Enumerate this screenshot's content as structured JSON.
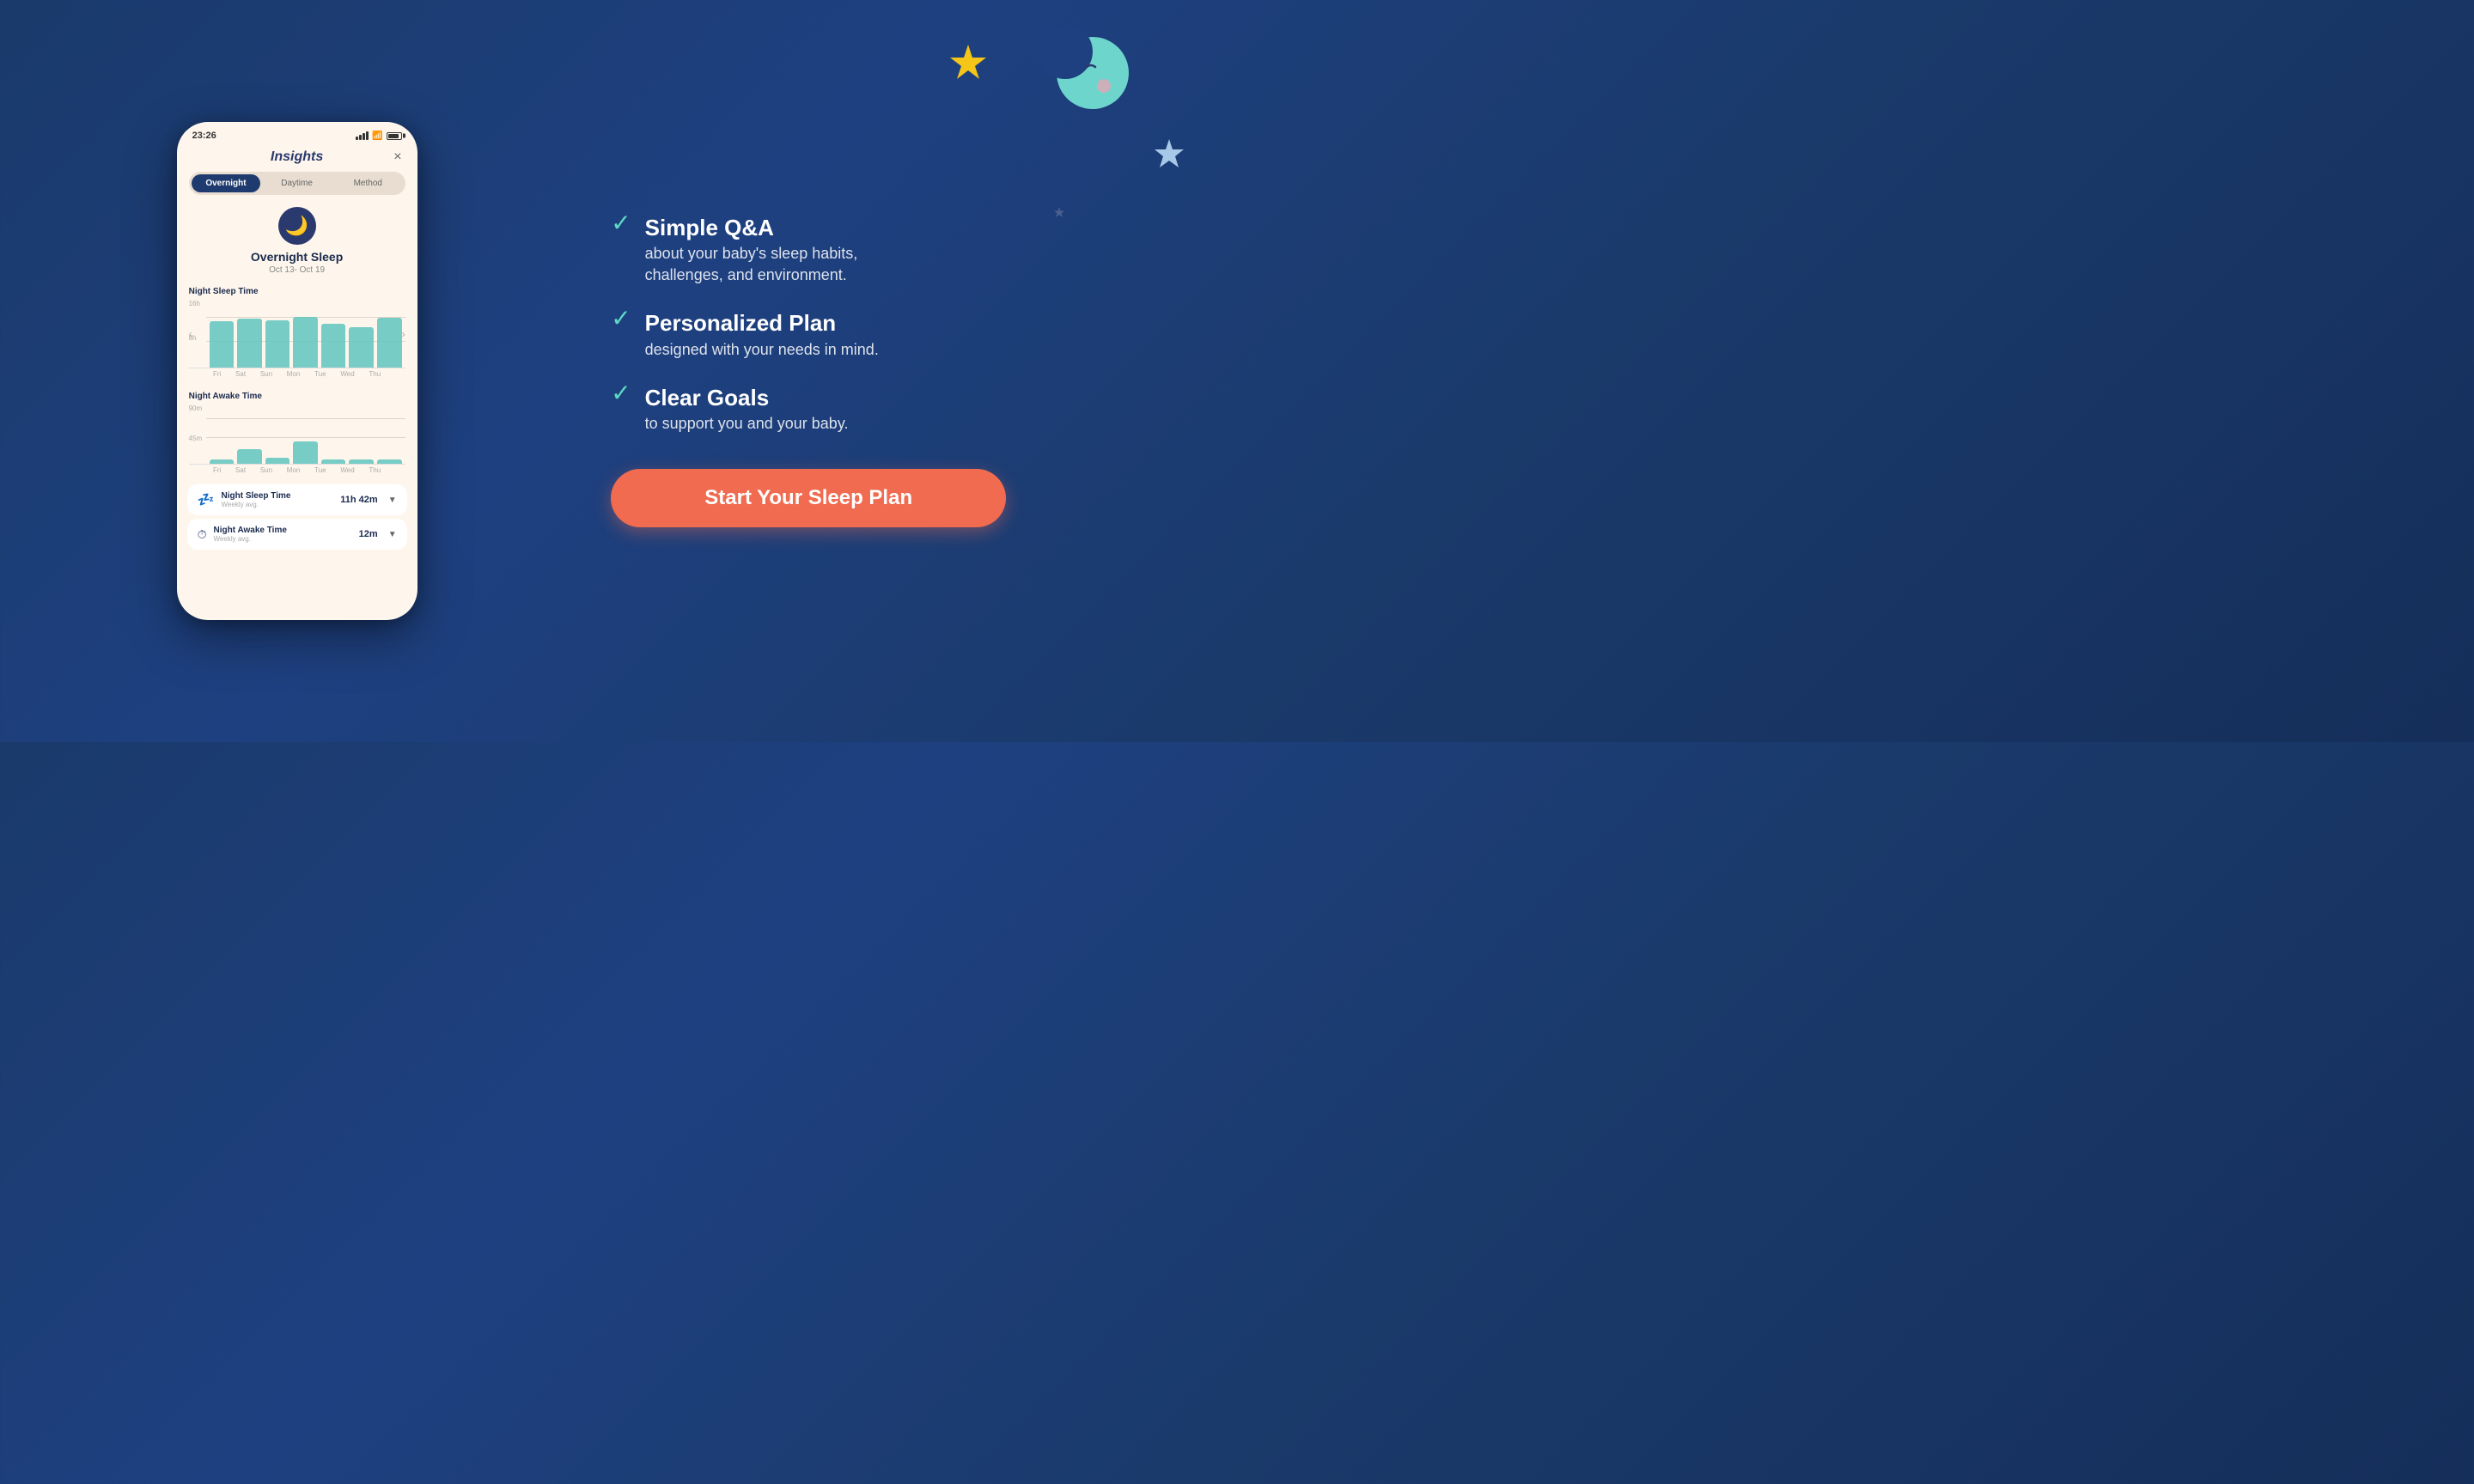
{
  "background": {
    "gradient_start": "#1a3a6b",
    "gradient_end": "#152e5a"
  },
  "phone": {
    "status_bar": {
      "time": "23:26",
      "notification_icon": "🔔"
    },
    "header": {
      "title": "Insights",
      "close_label": "×"
    },
    "tabs": [
      {
        "label": "Overnight",
        "active": true
      },
      {
        "label": "Daytime",
        "active": false
      },
      {
        "label": "Method",
        "active": false
      }
    ],
    "sleep_section": {
      "title": "Overnight Sleep",
      "date_range": "Oct 13- Oct 19",
      "icon": "🌙"
    },
    "night_sleep_chart": {
      "label": "Night Sleep Time",
      "y_axis": [
        "16h",
        "8h"
      ],
      "x_labels": [
        "Fri",
        "Sat",
        "Sun",
        "Mon",
        "Tue",
        "Wed",
        "Thu"
      ],
      "bars": [
        70,
        72,
        68,
        74,
        65,
        60,
        75
      ]
    },
    "night_awake_chart": {
      "label": "Night Awake Time",
      "y_axis": [
        "90m",
        "45m"
      ],
      "x_labels": [
        "Fri",
        "Sat",
        "Sun",
        "Mon",
        "Tue",
        "Wed",
        "Thu"
      ],
      "bars": [
        5,
        18,
        8,
        28,
        5,
        5,
        5
      ]
    },
    "stats": [
      {
        "icon": "💤",
        "name": "Night Sleep Time",
        "period": "Weekly avg.",
        "value": "11h 42m"
      },
      {
        "icon": "⏰",
        "name": "Night Awake Time",
        "period": "Weekly avg.",
        "value": "12m"
      }
    ]
  },
  "features": [
    {
      "checkmark": "✓",
      "title": "Simple Q&A",
      "description": "about your baby's sleep habits,\nchallenges, and environment."
    },
    {
      "checkmark": "✓",
      "title": "Personalized Plan",
      "description": "designed with your needs in mind."
    },
    {
      "checkmark": "✓",
      "title": "Clear Goals",
      "description": "to support you and your baby."
    }
  ],
  "cta": {
    "label": "Start Your Sleep Plan",
    "bg_color": "#f06b50"
  },
  "decorations": {
    "moon_emoji": "🌙",
    "star_yellow": "⭐",
    "star_blue": "✦",
    "star_small": "★"
  }
}
